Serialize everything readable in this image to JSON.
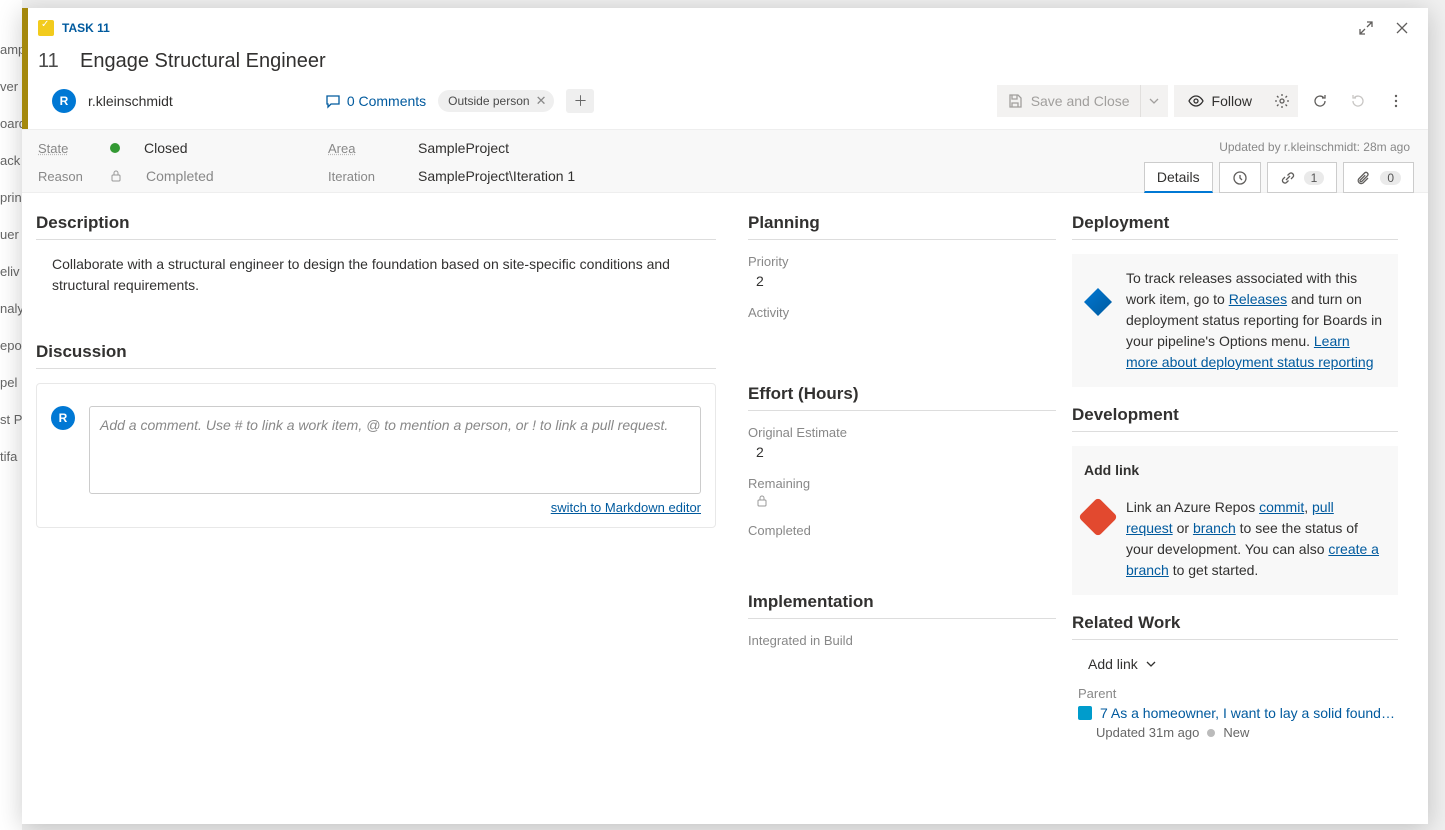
{
  "backgroundNav": [
    "amp",
    "ver",
    "oard",
    "ack",
    "prin",
    "uer",
    "eliv",
    "naly",
    "epo",
    "pel",
    "st P",
    "tifa"
  ],
  "header": {
    "taskType": "TASK 11",
    "taskId": "11",
    "taskTitle": "Engage Structural Engineer",
    "avatarInitial": "R",
    "username": "r.kleinschmidt",
    "commentsLabel": "0 Comments",
    "tag": "Outside person",
    "saveLabel": "Save and Close",
    "followLabel": "Follow"
  },
  "infoBar": {
    "stateLabel": "State",
    "stateValue": "Closed",
    "reasonLabel": "Reason",
    "reasonValue": "Completed",
    "areaLabel": "Area",
    "areaValue": "SampleProject",
    "iterationLabel": "Iteration",
    "iterationValue": "SampleProject\\Iteration 1",
    "updatedText": "Updated by r.kleinschmidt: 28m ago",
    "tabs": {
      "details": "Details",
      "linksCount": "1",
      "attachCount": "0"
    }
  },
  "left": {
    "descHeading": "Description",
    "descText": "Collaborate with a structural engineer to design the foundation based on site-specific conditions and structural requirements.",
    "discHeading": "Discussion",
    "commentPlaceholder": "Add a comment. Use # to link a work item, @ to mention a person, or ! to link a pull request.",
    "mdLink": "switch to Markdown editor"
  },
  "mid": {
    "planningHeading": "Planning",
    "priorityLabel": "Priority",
    "priorityValue": "2",
    "activityLabel": "Activity",
    "effortHeading": "Effort (Hours)",
    "origEstLabel": "Original Estimate",
    "origEstValue": "2",
    "remainingLabel": "Remaining",
    "completedLabel": "Completed",
    "implHeading": "Implementation",
    "integratedLabel": "Integrated in Build"
  },
  "right": {
    "deployHeading": "Deployment",
    "deployPre": "To track releases associated with this work item, go to ",
    "deployReleasesLink": "Releases",
    "deployMid": " and turn on deployment status reporting for Boards in your pipeline's Options menu. ",
    "deployLearnLink": "Learn more about deployment status reporting",
    "devHeading": "Development",
    "addLink": "Add link",
    "devPre": "Link an Azure Repos ",
    "devCommit": "commit",
    "devSep1": ", ",
    "devPR": "pull request",
    "devSep2": " or ",
    "devBranch": "branch",
    "devMid": " to see the status of your development. You can also ",
    "devCreate": "create a branch",
    "devPost": " to get started.",
    "relatedHeading": "Related Work",
    "parentLabel": "Parent",
    "parentLinkText": "7 As a homeowner, I want to lay a solid found…",
    "parentSub": "Updated 31m ago",
    "parentState": "New"
  }
}
